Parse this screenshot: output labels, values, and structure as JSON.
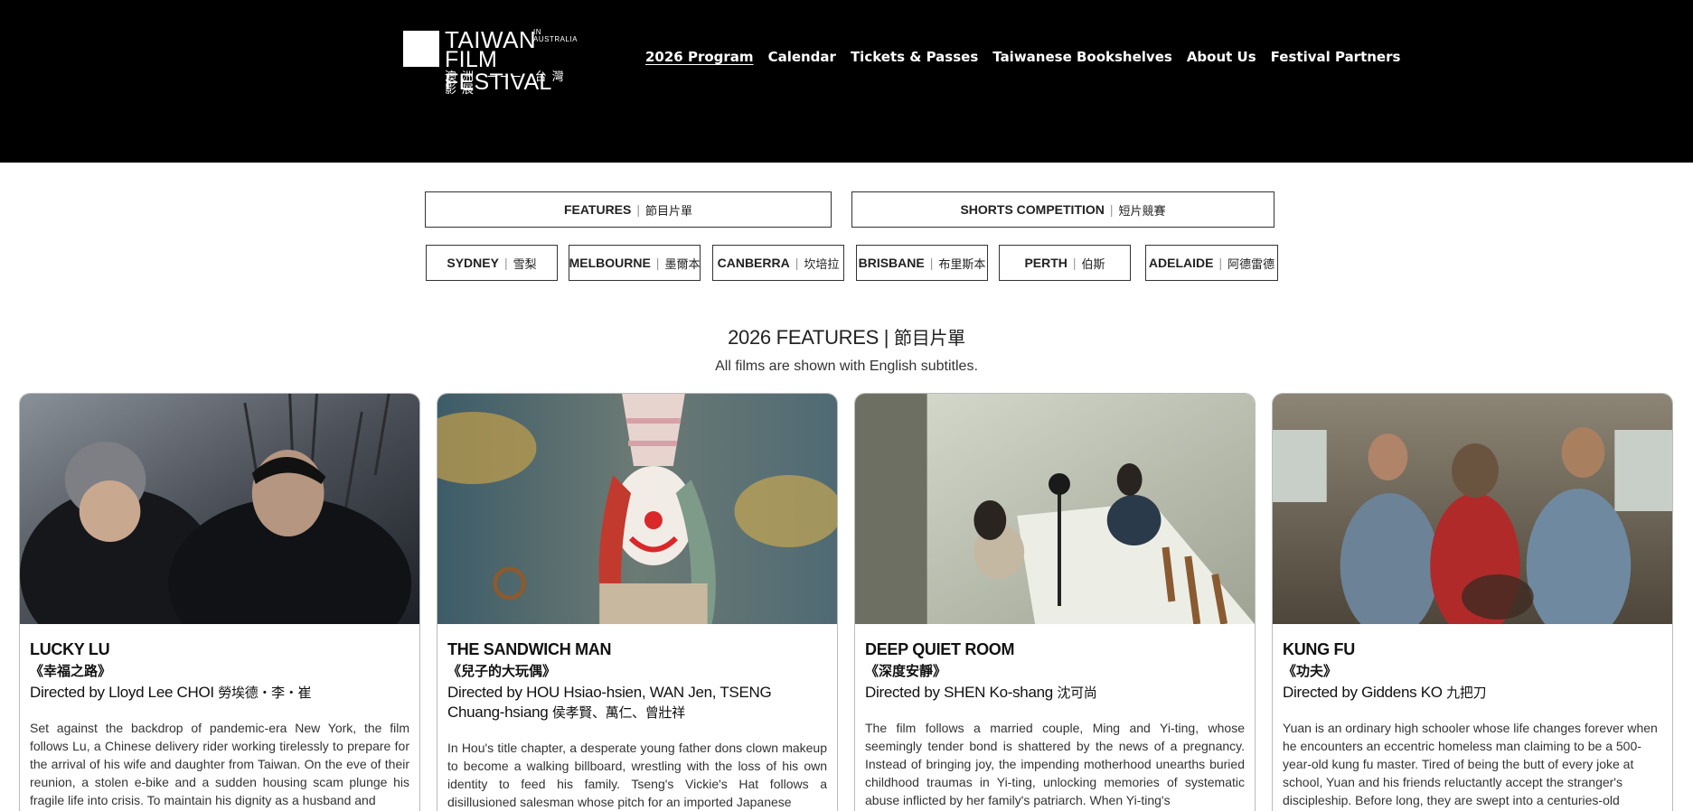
{
  "logo": {
    "line1": "TAIWAN",
    "in_australia": "IN AUSTRALIA",
    "line2": "FILM FESTIVAL",
    "line3": "澳洲 ─── 台灣影展"
  },
  "nav": [
    {
      "label": "2026 Program",
      "active": true
    },
    {
      "label": "Calendar"
    },
    {
      "label": "Tickets & Passes"
    },
    {
      "label": "Taiwanese Bookshelves"
    },
    {
      "label": "About Us"
    },
    {
      "label": "Festival Partners"
    }
  ],
  "sections": [
    {
      "en": "FEATURES",
      "zh": "節目片單"
    },
    {
      "en": "SHORTS COMPETITION",
      "zh": "短片競賽"
    }
  ],
  "cities": [
    {
      "en": "SYDNEY",
      "zh": "雪梨"
    },
    {
      "en": "MELBOURNE",
      "zh": "墨爾本"
    },
    {
      "en": "CANBERRA",
      "zh": "坎培拉"
    },
    {
      "en": "BRISBANE",
      "zh": "布里斯本"
    },
    {
      "en": "PERTH",
      "zh": "伯斯"
    },
    {
      "en": "ADELAIDE",
      "zh": "阿德雷德"
    }
  ],
  "heading": {
    "en": "2026 FEATURES |",
    "zh": "節目片單",
    "subtitle": "All films are shown with English subtitles."
  },
  "films": [
    {
      "title": "LUCKY LU",
      "zh_title": "《幸福之路》",
      "director": "Directed by Lloyd Lee CHOI",
      "director_zh": "勞埃德・李・崔",
      "description": "Set against the backdrop of pandemic-era New York, the film follows Lu, a Chinese delivery rider working tirelessly to prepare for the arrival of his wife and daughter from Taiwan. On the eve of their reunion, a stolen e-bike and a sudden housing scam plunge his fragile life into crisis. To maintain his dignity as a husband and"
    },
    {
      "title": "THE SANDWICH MAN",
      "zh_title": "《兒子的大玩偶》",
      "director": "Directed by  HOU Hsiao-hsien, WAN Jen, TSENG Chuang-hsiang",
      "director_zh": "侯孝賢、萬仁、曾壯祥",
      "description": "In Hou's title chapter, a desperate young father dons clown makeup to become a walking billboard, wrestling with the loss of his own identity to feed his family. Tseng's Vickie's Hat follows a disillusioned salesman whose pitch for an imported Japanese"
    },
    {
      "title": "DEEP QUIET ROOM",
      "zh_title": "《深度安靜》",
      "director": "Directed by SHEN Ko-shang",
      "director_zh": "沈可尚",
      "description": "The film follows a married couple, Ming and Yi-ting, whose seemingly tender bond is shattered by the news of a pregnancy. Instead of bringing joy, the impending motherhood unearths buried childhood traumas in Yi-ting, unlocking memories of systematic abuse inflicted by her family's patriarch. When Yi-ting's"
    },
    {
      "title": "KUNG FU",
      "zh_title": "《功夫》",
      "director": "Directed by Giddens KO",
      "director_zh": "九把刀",
      "description": "Yuan is an ordinary high schooler whose life changes forever when he encounters an eccentric homeless man claiming to be a 500-year-old kung fu master. Tired of being the butt of every joke at school, Yuan and his friends reluctantly accept the stranger's discipleship. Before long, they are swept into a centuries-old"
    }
  ]
}
